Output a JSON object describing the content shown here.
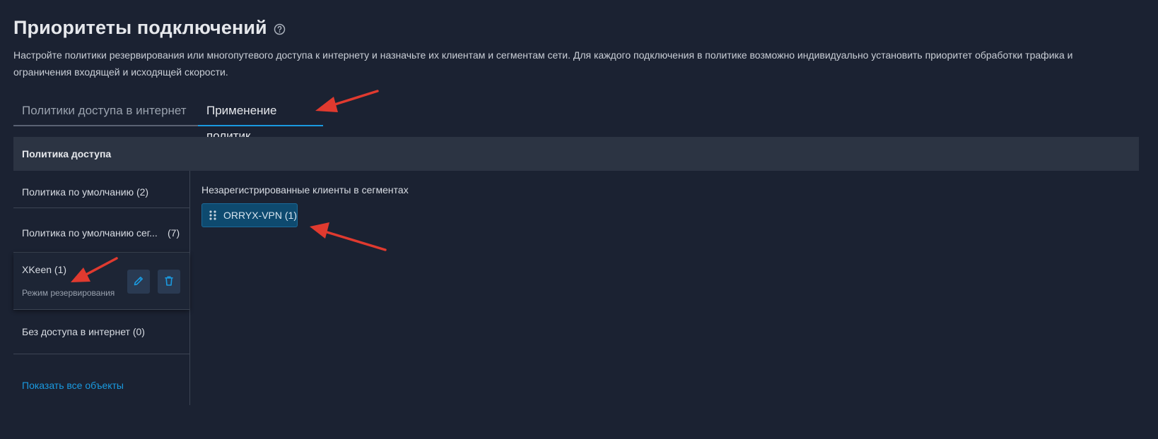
{
  "page": {
    "title": "Приоритеты подключений",
    "description": "Настройте политики резервирования или многопутевого доступа к интернету и назначьте их клиентам и сегментам сети. Для каждого подключения в политике возможно индивидуально установить приоритет обработки трафика и ограничения входящей и исходящей скорости."
  },
  "tabs": [
    {
      "label": "Политики доступа в интернет",
      "active": false
    },
    {
      "label": "Применение политик",
      "active": true
    }
  ],
  "table": {
    "header": "Политика доступа"
  },
  "policies": [
    {
      "label": "Политика по умолчанию (2)",
      "count": ""
    },
    {
      "label": "Политика по умолчанию сег...",
      "count": "(7)"
    },
    {
      "label": "XKeen (1)",
      "count": "",
      "subtitle": "Режим резервирования",
      "selected": true
    },
    {
      "label": "Без доступа в интернет (0)",
      "count": ""
    }
  ],
  "show_all_label": "Показать все объекты",
  "right_panel": {
    "title": "Незарегистрированные клиенты в сегментах",
    "chips": [
      {
        "label": "ORRYX-VPN (1)"
      }
    ]
  },
  "icons": {
    "help": "help-circle-icon",
    "edit": "pencil-icon",
    "delete": "trash-icon",
    "drag": "drag-handle-icon"
  },
  "colors": {
    "background": "#1b2232",
    "header_bg": "#2c3443",
    "accent": "#1a9ae0",
    "chip_bg": "#0e4a6f",
    "annotation_arrow": "#e03a2f"
  }
}
